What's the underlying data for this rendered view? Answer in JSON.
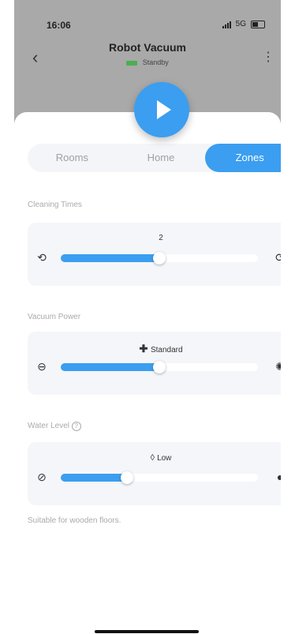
{
  "status": {
    "time": "16:06",
    "network": "5G"
  },
  "header": {
    "title": "Robot Vacuum",
    "subtitle": "Standby"
  },
  "tabs": [
    {
      "label": "Rooms",
      "active": false
    },
    {
      "label": "Home",
      "active": false
    },
    {
      "label": "Zones",
      "active": true
    }
  ],
  "cleaning_times": {
    "label": "Cleaning Times",
    "value": "2",
    "fill_fraction": 0.5
  },
  "vacuum_power": {
    "label": "Vacuum Power",
    "value": "Standard",
    "fill_fraction": 0.5
  },
  "water_level": {
    "label": "Water Level",
    "value": "Low",
    "fill_fraction": 0.33
  },
  "note": "Suitable for wooden floors.",
  "colors": {
    "accent": "#3b9ef0",
    "header_bg": "#a9a9a9",
    "card_bg": "#f4f6fa"
  }
}
